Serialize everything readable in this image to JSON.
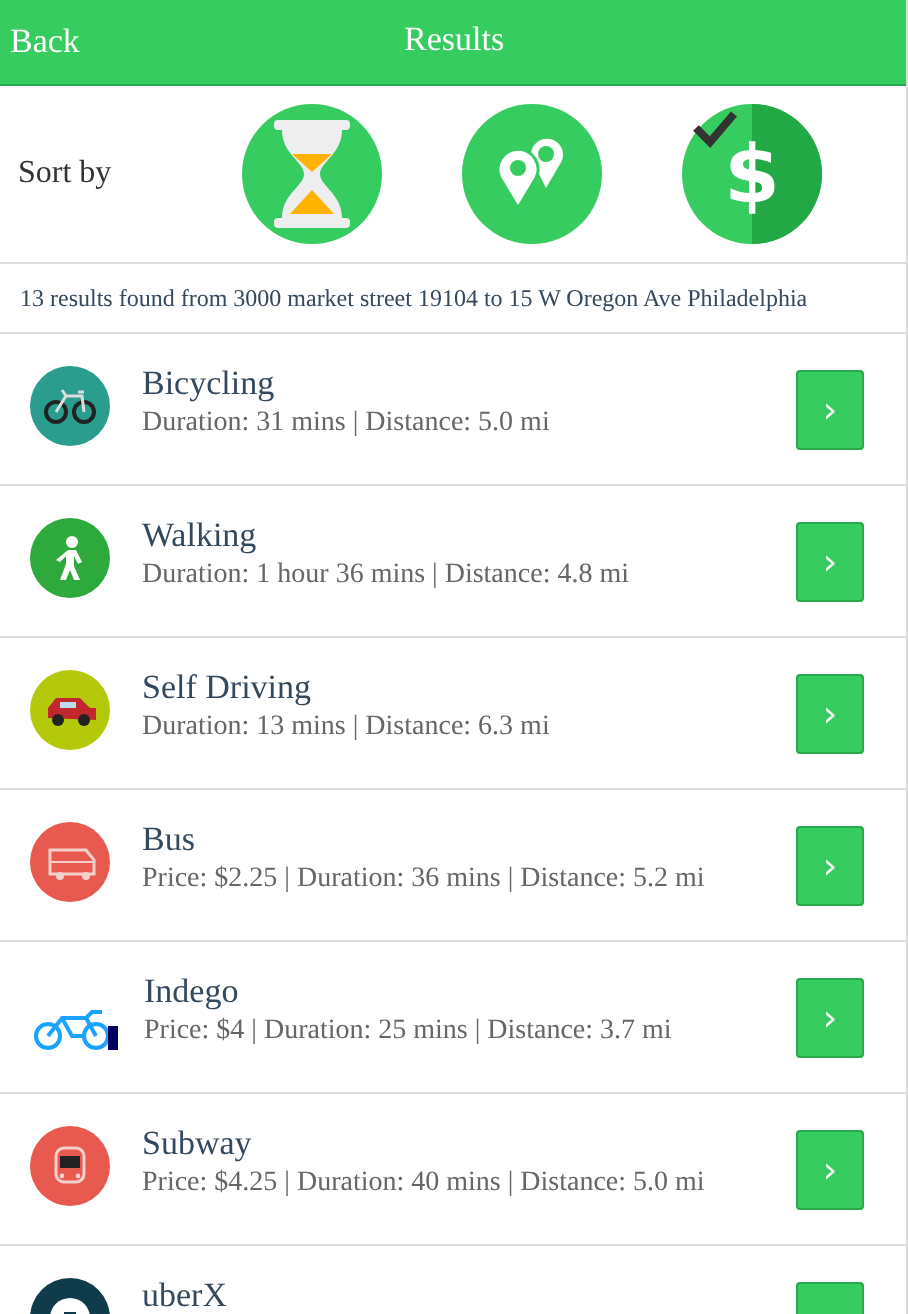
{
  "header": {
    "back": "Back",
    "title": "Results"
  },
  "sort": {
    "label": "Sort by",
    "options": [
      {
        "kind": "time",
        "selected": false
      },
      {
        "kind": "places",
        "selected": false
      },
      {
        "kind": "price",
        "selected": true,
        "symbol": "$"
      }
    ]
  },
  "summary": "13 results found from 3000 market street 19104 to 15 W Oregon Ave Philadelphia",
  "results": [
    {
      "kind": "bicycle",
      "name": "Bicycling",
      "details": "Duration: 31 mins | Distance: 5.0 mi",
      "action": "›"
    },
    {
      "kind": "walk",
      "name": "Walking",
      "details": "Duration: 1 hour 36 mins | Distance: 4.8 mi",
      "action": "›"
    },
    {
      "kind": "car",
      "name": "Self Driving",
      "details": "Duration: 13 mins | Distance: 6.3 mi",
      "action": "›"
    },
    {
      "kind": "bus",
      "name": "Bus",
      "details": "Price: $2.25 | Duration: 36 mins | Distance: 5.2 mi",
      "action": "›"
    },
    {
      "kind": "indego",
      "name": "Indego",
      "details": "Price: $4 | Duration: 25 mins | Distance: 3.7 mi",
      "action": "›"
    },
    {
      "kind": "subway",
      "name": "Subway",
      "details": "Price: $4.25 | Duration: 40 mins | Distance: 5.0 mi",
      "action": "›"
    },
    {
      "kind": "uber",
      "name": "uberX"
    }
  ]
}
